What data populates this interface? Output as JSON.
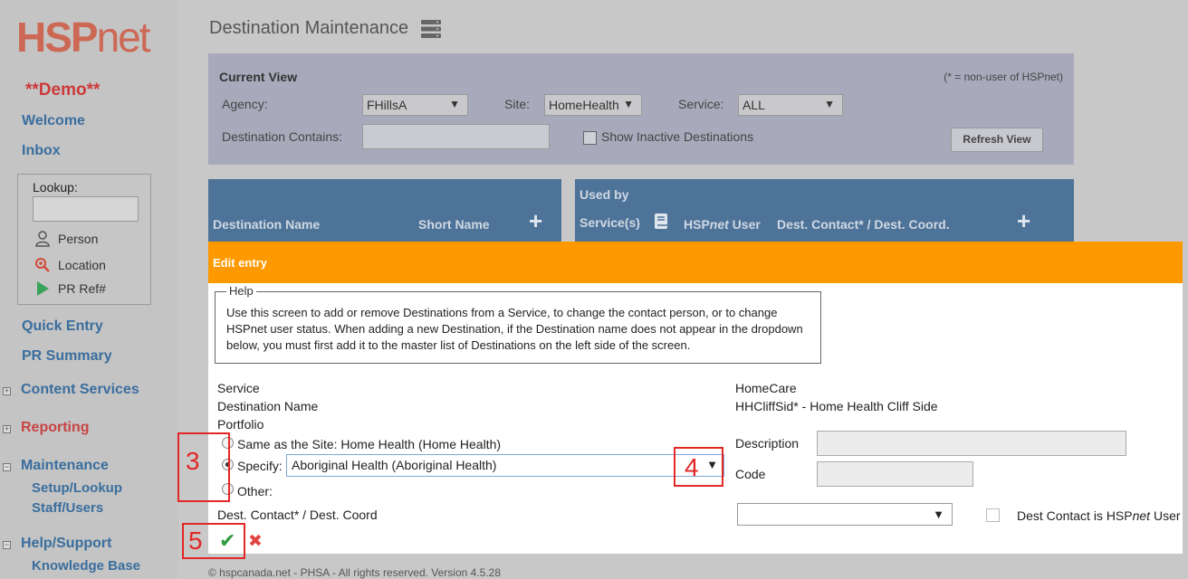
{
  "sidebar": {
    "logo_hsp": "HSP",
    "logo_net": "net",
    "demo": "**Demo**",
    "welcome": "Welcome",
    "inbox": "Inbox",
    "lookup": {
      "label": "Lookup",
      "person": "Person",
      "location": "Location",
      "pr_ref": "PR Ref#"
    },
    "quick_entry": "Quick Entry",
    "pr_summary": "PR Summary",
    "content_services": "Content Services",
    "reporting": "Reporting",
    "maintenance": "Maintenance",
    "setup_lookup": "Setup/Lookup",
    "staff_users": "Staff/Users",
    "help_support": "Help/Support",
    "knowledge_base": "Knowledge Base",
    "expand_symbol": "+",
    "collapse_symbol": "−"
  },
  "page": {
    "title": "Destination Maintenance"
  },
  "current_view": {
    "title": "Current View",
    "note": "(* = non-user of HSPnet)",
    "agency_label": "Agency:",
    "agency_value": "FHillsA",
    "site_label": "Site:",
    "site_value": "HomeHealth",
    "service_label": "Service:",
    "service_value": "ALL",
    "destination_contains_label": "Destination Contains:",
    "destination_contains_value": "",
    "show_inactive_label": "Show Inactive Destinations",
    "refresh_label": "Refresh View"
  },
  "left_table": {
    "col_destination_name": "Destination Name",
    "col_short_name": "Short Name",
    "add": "+"
  },
  "right_table": {
    "used_by": "Used by",
    "col_services": "Service(s)",
    "col_hspnet_user_pre": "HSP",
    "col_hspnet_user_em": "net",
    "col_hspnet_user_post": " User",
    "col_dest_contact": "Dest. Contact* / Dest. Coord.",
    "add": "+"
  },
  "edit": {
    "bar_title": "Edit entry",
    "help_legend": "Help",
    "help_text": "Use this screen to add or remove Destinations from a Service, to change the contact person, or to change HSPnet user status. When adding a new Destination, if the Destination name does not appear in the dropdown below, you must first add it to the master list of Destinations on the left side of the screen.",
    "service_label": "Service",
    "service_value": "HomeCare",
    "destination_name_label": "Destination Name",
    "destination_name_value": "HHCliffSid* - Home Health Cliff Side",
    "portfolio_label": "Portfolio",
    "radio_same": "Same as the Site: Home Health (Home Health)",
    "radio_specify": "Specify:",
    "specify_value": "Aboriginal Health (Aboriginal Health)",
    "radio_other": "Other:",
    "description_label": "Description",
    "code_label": "Code",
    "dest_contact_label": "Dest. Contact* / Dest. Coord",
    "dest_contact_value": "",
    "dest_contact_is_user_pre": "Dest Contact is HSP",
    "dest_contact_is_user_em": "net",
    "dest_contact_is_user_post": " User",
    "save_glyph": "✔",
    "cancel_glyph": "✖"
  },
  "annotations": {
    "a3": "3",
    "a4": "4",
    "a5": "5"
  },
  "footer": {
    "text": "© hspcanada.net - PHSA - All rights reserved.     Version 4.5.28"
  },
  "icons": {
    "server": "server-icon",
    "person": "person-icon",
    "location": "location-search-icon",
    "pr_ref": "play-icon",
    "book": "book-icon",
    "save": "check-icon",
    "cancel": "x-icon",
    "dropdown": "chevron-down-icon"
  },
  "colors": {
    "orange": "#ff9900",
    "table_header": "#4e7399",
    "nav_blue": "#3a6e9e",
    "nav_red": "#c94343",
    "annotation_red": "#e32626",
    "save_green": "#2e9b3e"
  },
  "radio_selected": "specify"
}
